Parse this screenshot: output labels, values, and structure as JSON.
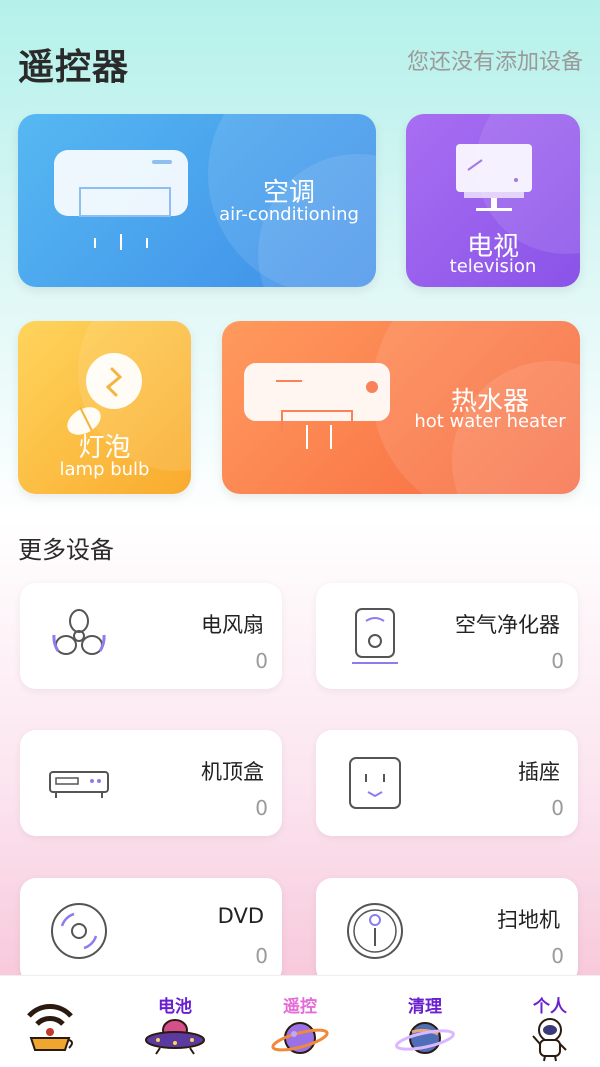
{
  "header": {
    "title": "遥控器",
    "subtitle": "您还没有添加设备"
  },
  "cards": {
    "ac": {
      "zh": "空调",
      "en": "air-conditioning",
      "icon": "air-conditioner-icon"
    },
    "tv": {
      "zh": "电视",
      "en": "television",
      "icon": "television-icon"
    },
    "lamp": {
      "zh": "灯泡",
      "en": "lamp bulb",
      "icon": "lamp-bulb-icon"
    },
    "heater": {
      "zh": "热水器",
      "en": "hot water heater",
      "icon": "water-heater-icon"
    }
  },
  "more": {
    "title": "更多设备",
    "devices": [
      {
        "name": "电风扇",
        "count": "0",
        "icon": "fan-icon"
      },
      {
        "name": "空气净化器",
        "count": "0",
        "icon": "air-purifier-icon"
      },
      {
        "name": "机顶盒",
        "count": "0",
        "icon": "set-top-box-icon"
      },
      {
        "name": "插座",
        "count": "0",
        "icon": "socket-icon"
      },
      {
        "name": "DVD",
        "count": "0",
        "icon": "dvd-icon"
      },
      {
        "name": "扫地机",
        "count": "0",
        "icon": "robot-vacuum-icon"
      }
    ]
  },
  "tabbar": {
    "tabs": [
      {
        "label": "",
        "icon": "wifi-cup-icon"
      },
      {
        "label": "电池",
        "icon": "ufo-icon"
      },
      {
        "label": "遥控",
        "icon": "planet-icon"
      },
      {
        "label": "清理",
        "icon": "ringed-planet-icon"
      },
      {
        "label": "个人",
        "icon": "astronaut-icon"
      }
    ],
    "colors": {
      "label": "#6a1fd0"
    }
  },
  "colors": {
    "ac": "#4a9ff0",
    "tv": "#9a60ee",
    "lamp": "#fcc046",
    "heater": "#fa7f4a"
  }
}
